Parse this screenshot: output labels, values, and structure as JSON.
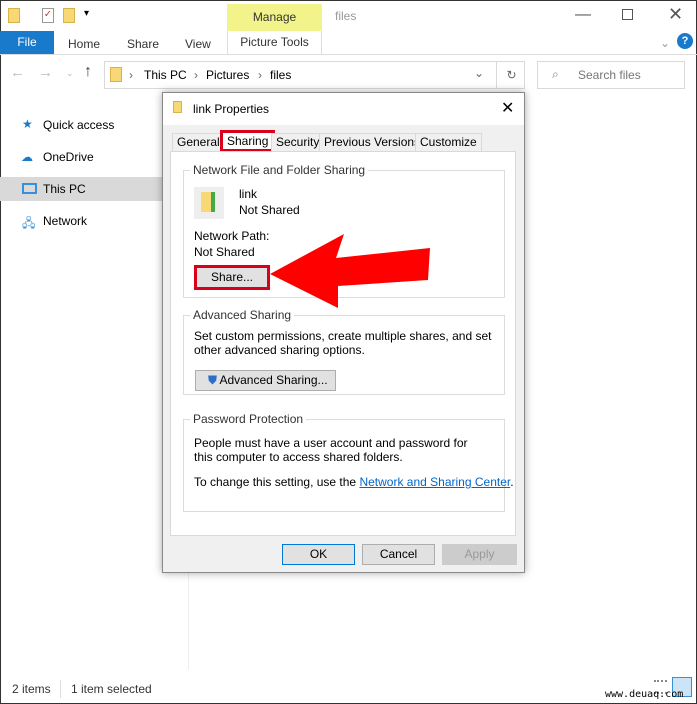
{
  "window": {
    "title": "files",
    "contextual_tab": "Manage",
    "contextual_group": "Picture Tools"
  },
  "ribbon": {
    "tabs": [
      "File",
      "Home",
      "Share",
      "View"
    ],
    "help": "?"
  },
  "address": {
    "crumbs": [
      "This PC",
      "Pictures",
      "files"
    ],
    "search_placeholder": "Search files"
  },
  "sidebar": {
    "items": [
      "Quick access",
      "OneDrive",
      "This PC",
      "Network"
    ]
  },
  "status": {
    "items": "2 items",
    "selected": "1 item selected"
  },
  "watermark": "www.deuaq.com",
  "dialog": {
    "title": "link Properties",
    "tabs": [
      "General",
      "Sharing",
      "Security",
      "Previous Versions",
      "Customize"
    ],
    "network_group": "Network File and Folder Sharing",
    "item_name": "link",
    "item_status": "Not Shared",
    "path_label": "Network Path:",
    "path_value": "Not Shared",
    "share_button": "Share...",
    "advanced_group": "Advanced Sharing",
    "advanced_desc": "Set custom permissions, create multiple shares, and set other advanced sharing options.",
    "advanced_button": "Advanced Sharing...",
    "password_group": "Password Protection",
    "password_desc": "People must have a user account and password for this computer to access shared folders.",
    "password_change": "To change this setting, use the",
    "password_link": "Network and Sharing Center",
    "ok": "OK",
    "cancel": "Cancel",
    "apply": "Apply"
  },
  "colors": {
    "accent": "#1979ca",
    "highlight": "#e00000",
    "manage": "#f3f38c"
  }
}
